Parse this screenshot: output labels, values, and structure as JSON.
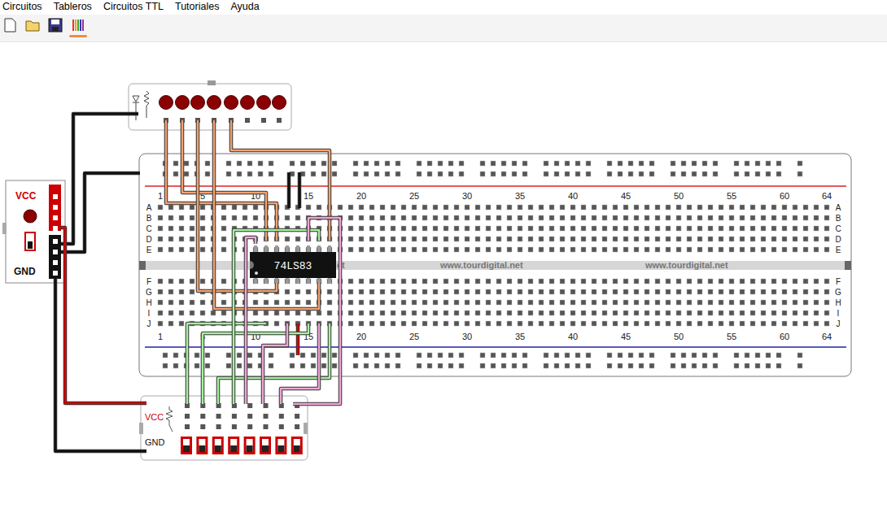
{
  "menu": [
    {
      "label": "Circuitos"
    },
    {
      "label": "Tableros"
    },
    {
      "label": "Circuitos TTL"
    },
    {
      "label": "Tutoriales"
    },
    {
      "label": "Ayuda"
    }
  ],
  "toolbar": [
    {
      "selected": false
    },
    {
      "selected": false
    },
    {
      "selected": false
    },
    {
      "selected": true
    }
  ],
  "power_supply": {
    "vcc_label": "VCC",
    "gnd_label": "GND",
    "led_on": false,
    "switch_on": false
  },
  "led_bar": {
    "leds": [
      {
        "on": false
      },
      {
        "on": false
      },
      {
        "on": false
      },
      {
        "on": false
      },
      {
        "on": false
      },
      {
        "on": false
      },
      {
        "on": false
      },
      {
        "on": false
      }
    ]
  },
  "breadboard": {
    "columns": [
      "1",
      "5",
      "10",
      "15",
      "20",
      "25",
      "30",
      "35",
      "40",
      "45",
      "50",
      "55",
      "60",
      "64"
    ],
    "rows_top": [
      "A",
      "B",
      "C",
      "D",
      "E"
    ],
    "rows_bottom": [
      "F",
      "G",
      "H",
      "I",
      "J"
    ],
    "watermarks": [
      "et",
      "www.tourdigital.net",
      "www.tourdigital.net"
    ]
  },
  "chip": {
    "label": "74LS83"
  },
  "switch_board": {
    "vcc_label": "VCC",
    "gnd_label": "GND",
    "switches": [
      {
        "on": false
      },
      {
        "on": false
      },
      {
        "on": false
      },
      {
        "on": false
      },
      {
        "on": false
      },
      {
        "on": false
      },
      {
        "on": false
      },
      {
        "on": false
      }
    ]
  },
  "wires": [
    {
      "color": "#f2a272"
    },
    {
      "color": "#f2a272"
    },
    {
      "color": "#f2a272"
    },
    {
      "color": "#f2a272"
    },
    {
      "color": "#f2a272"
    },
    {
      "color": "#111111"
    },
    {
      "color": "#111111"
    },
    {
      "color": "#111111"
    },
    {
      "color": "#111111"
    },
    {
      "color": "#111111"
    },
    {
      "color": "#dd0000"
    },
    {
      "color": "#dd0000"
    },
    {
      "color": "#a8f0a0"
    },
    {
      "color": "#a8f0a0"
    },
    {
      "color": "#a8f0a0"
    },
    {
      "color": "#a8f0a0"
    },
    {
      "color": "#f0a6d6"
    },
    {
      "color": "#f0a6d6"
    },
    {
      "color": "#f0a6d6"
    },
    {
      "color": "#f0a6d6"
    }
  ]
}
